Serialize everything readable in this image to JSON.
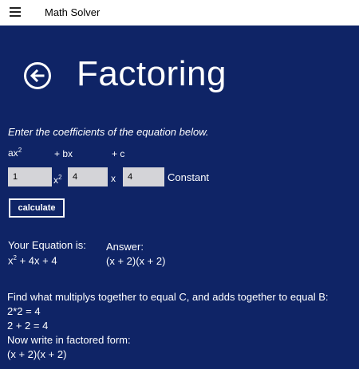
{
  "app": {
    "title": "Math Solver"
  },
  "page": {
    "title": "Factoring"
  },
  "form": {
    "instructions": "Enter the coefficients of the equation below.",
    "terms": {
      "a_label": "ax",
      "a_exp": "2",
      "b_label": "+ bx",
      "c_label": "+ c"
    },
    "inputs": {
      "a": "1",
      "b": "4",
      "c": "4"
    },
    "var_x": "x",
    "var_x2_exp": "2",
    "constant_label": "Constant",
    "calculate_label": "calculate"
  },
  "result": {
    "equation_label": "Your Equation is:",
    "equation_pre": "x",
    "equation_exp": "2",
    "equation_post": " + 4x + 4",
    "answer_label": "Answer:",
    "answer": "(x + 2)(x + 2)"
  },
  "steps": [
    "Find what multiplys together to equal C, and adds together to equal B:",
    "2*2 = 4",
    "2 + 2 = 4",
    "Now write in factored form:",
    "(x + 2)(x + 2)"
  ]
}
